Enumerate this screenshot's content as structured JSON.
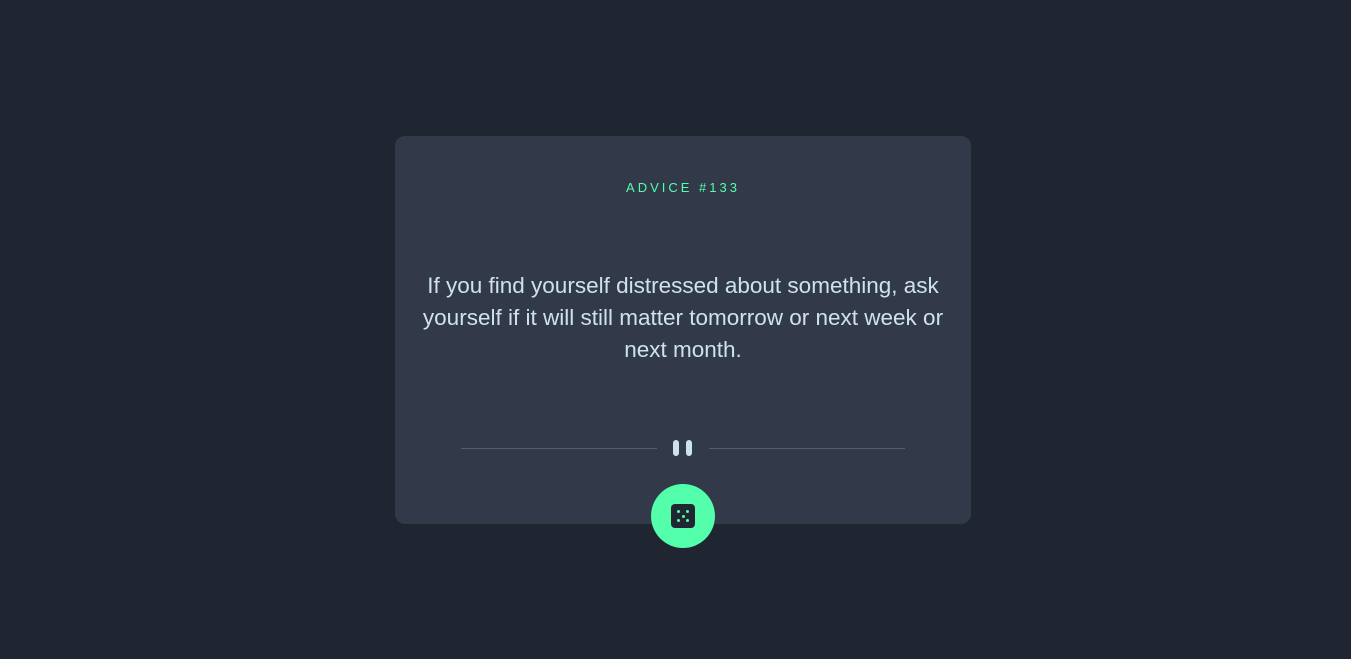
{
  "card": {
    "advice_label": "ADVICE #133",
    "advice_text": "If you find yourself distressed about something, ask yourself if it will still matter tomorrow or next week or next month."
  },
  "divider": {
    "icon": "pause-icon"
  },
  "button": {
    "icon": "dice-icon"
  },
  "colors": {
    "background": "#1f2531",
    "card": "#323a4a",
    "accent": "#53ffaa",
    "text": "#cee3e9"
  }
}
